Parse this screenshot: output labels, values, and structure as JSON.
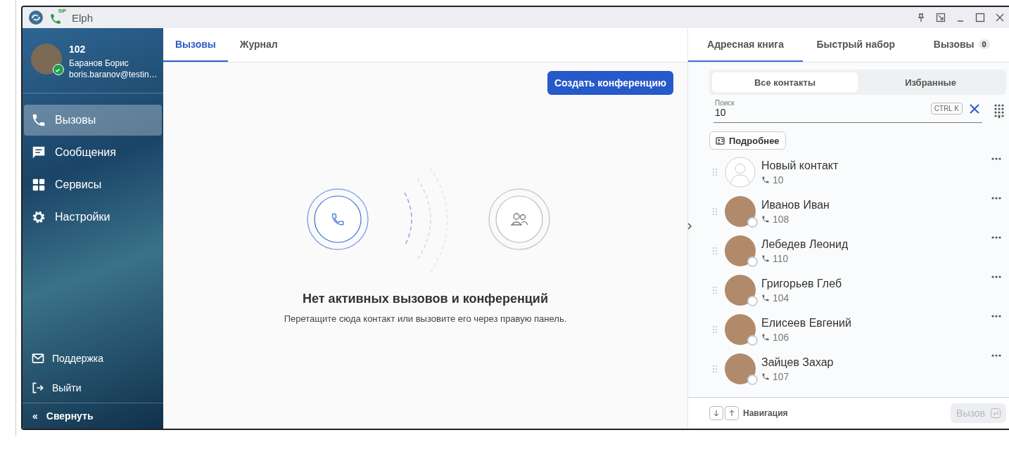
{
  "window": {
    "title": "Elph",
    "sip_label": "SIP"
  },
  "user": {
    "extension": "102",
    "name": "Баранов Борис",
    "email": "boris.baranov@testin…",
    "online": true
  },
  "nav": [
    {
      "label": "Вызовы",
      "selected": true
    },
    {
      "label": "Сообщения",
      "selected": false
    },
    {
      "label": "Сервисы",
      "selected": false
    },
    {
      "label": "Настройки",
      "selected": false
    }
  ],
  "sidebar_footer": [
    {
      "label": "Поддержка"
    },
    {
      "label": "Выйти"
    }
  ],
  "collapse": {
    "label": "Свернуть",
    "icon": "«"
  },
  "main_tabs": [
    {
      "label": "Вызовы",
      "selected": true
    },
    {
      "label": "Журнал",
      "selected": false
    }
  ],
  "create_conference_button": "Создать конференцию",
  "empty_state": {
    "title": "Нет активных вызовов и конференций",
    "text": "Перетащите сюда контакт или вызовите его через правую панель."
  },
  "right_tabs": [
    {
      "label": "Адресная книга",
      "selected": true
    },
    {
      "label": "Быстрый набор",
      "selected": false
    },
    {
      "label": "Вызовы",
      "selected": false,
      "badge": "0"
    }
  ],
  "segments": [
    {
      "label": "Все контакты",
      "selected": true
    },
    {
      "label": "Избранные",
      "selected": false
    }
  ],
  "search": {
    "label": "Поиск",
    "value": "10",
    "shortcut": "CTRL K"
  },
  "details_button": "Подробнее",
  "contacts": [
    {
      "name": "Новый контакт",
      "number": "10",
      "kind": "placeholder"
    },
    {
      "name": "Иванов Иван",
      "number": "108",
      "kind": "photo",
      "online": false
    },
    {
      "name": "Лебедев Леонид",
      "number": "110",
      "kind": "photo",
      "online": false
    },
    {
      "name": "Григорьев Глеб",
      "number": "104",
      "kind": "photo",
      "online": false
    },
    {
      "name": "Елисеев Евгений",
      "number": "106",
      "kind": "photo",
      "online": false
    },
    {
      "name": "Зайцев Захар",
      "number": "107",
      "kind": "photo",
      "online": false
    }
  ],
  "footer": {
    "navigation_label": "Навигация",
    "call_button": "Вызов",
    "call_disabled": true
  }
}
